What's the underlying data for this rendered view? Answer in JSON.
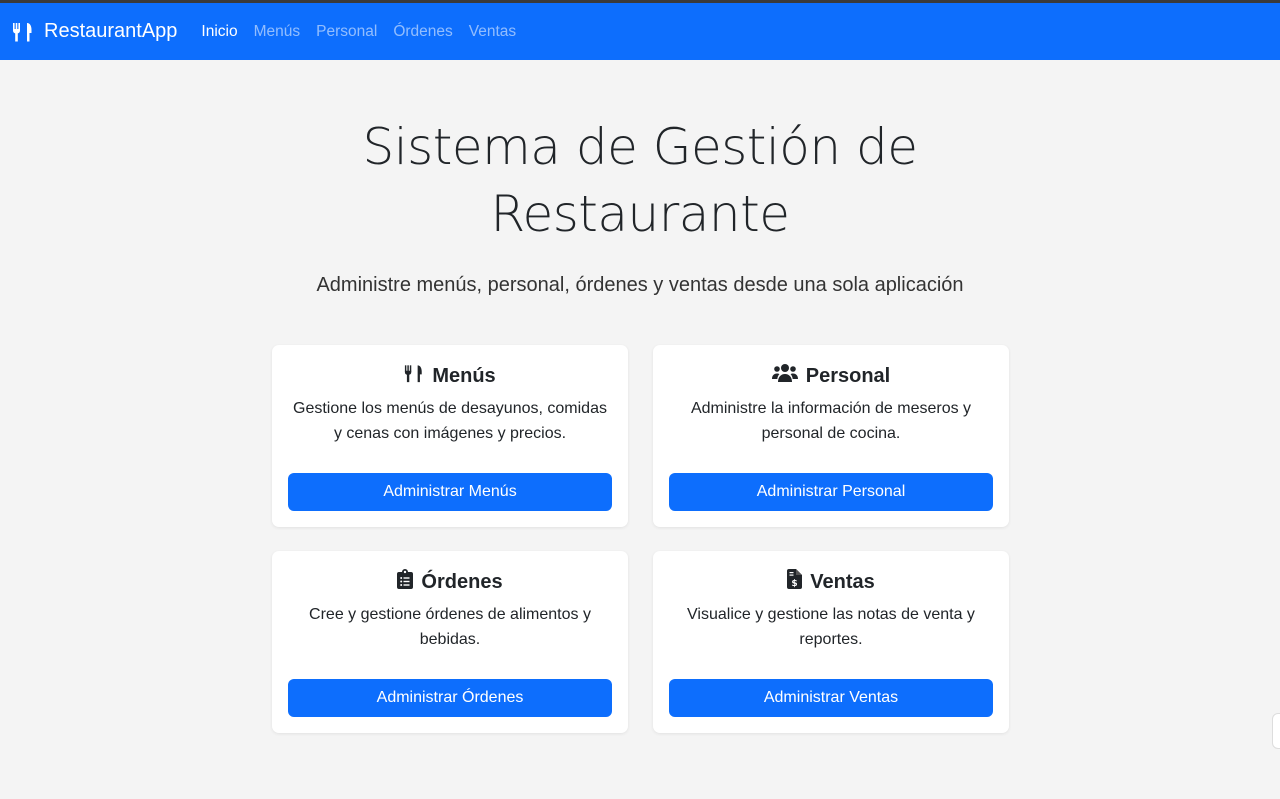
{
  "navbar": {
    "brand": "RestaurantApp",
    "brand_icon": "utensils-icon",
    "links": [
      {
        "label": "Inicio",
        "active": true
      },
      {
        "label": "Menús",
        "active": false
      },
      {
        "label": "Personal",
        "active": false
      },
      {
        "label": "Órdenes",
        "active": false
      },
      {
        "label": "Ventas",
        "active": false
      }
    ]
  },
  "hero": {
    "title": "Sistema de Gestión de Restaurante",
    "subtitle": "Administre menús, personal, órdenes y ventas desde una sola aplicación"
  },
  "cards": [
    {
      "icon": "utensils-icon",
      "title": "Menús",
      "text": "Gestione los menús de desayunos, comidas y cenas con imágenes y precios.",
      "button": "Administrar Menús"
    },
    {
      "icon": "users-icon",
      "title": "Personal",
      "text": "Administre la información de meseros y personal de cocina.",
      "button": "Administrar Personal"
    },
    {
      "icon": "clipboard-list-icon",
      "title": "Órdenes",
      "text": "Cree y gestione órdenes de alimentos y bebidas.",
      "button": "Administrar Órdenes"
    },
    {
      "icon": "file-invoice-dollar-icon",
      "title": "Ventas",
      "text": "Visualice y gestione las notas de venta y reportes.",
      "button": "Administrar Ventas"
    }
  ],
  "colors": {
    "primary": "#0d6efd",
    "background": "#f4f4f4",
    "card": "#ffffff"
  }
}
